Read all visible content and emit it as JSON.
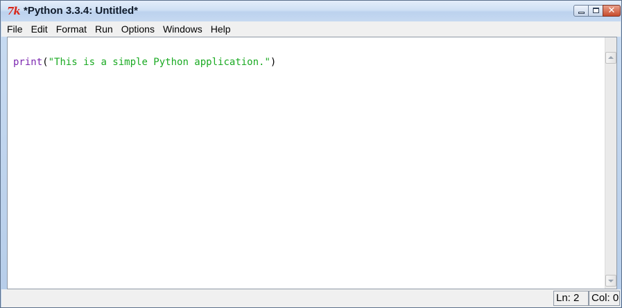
{
  "window": {
    "title": "*Python 3.3.4: Untitled*",
    "app_icon_text": "7k"
  },
  "menubar": {
    "items": [
      {
        "label": "File"
      },
      {
        "label": "Edit"
      },
      {
        "label": "Format"
      },
      {
        "label": "Run"
      },
      {
        "label": "Options"
      },
      {
        "label": "Windows"
      },
      {
        "label": "Help"
      }
    ]
  },
  "editor": {
    "code": {
      "builtin": "print",
      "open_paren": "(",
      "string": "\"This is a simple Python application.\"",
      "close_paren": ")"
    }
  },
  "statusbar": {
    "line": "Ln: 2",
    "column": "Col: 0"
  },
  "colors": {
    "builtin": "#7c27b0",
    "string": "#1aaa22",
    "close_button": "#c74b2c"
  },
  "icons": {
    "app": "tk-feather-icon",
    "minimize": "minimize-icon",
    "maximize": "maximize-icon",
    "close": "close-icon",
    "scroll_up": "chevron-up-icon",
    "scroll_down": "chevron-down-icon"
  }
}
